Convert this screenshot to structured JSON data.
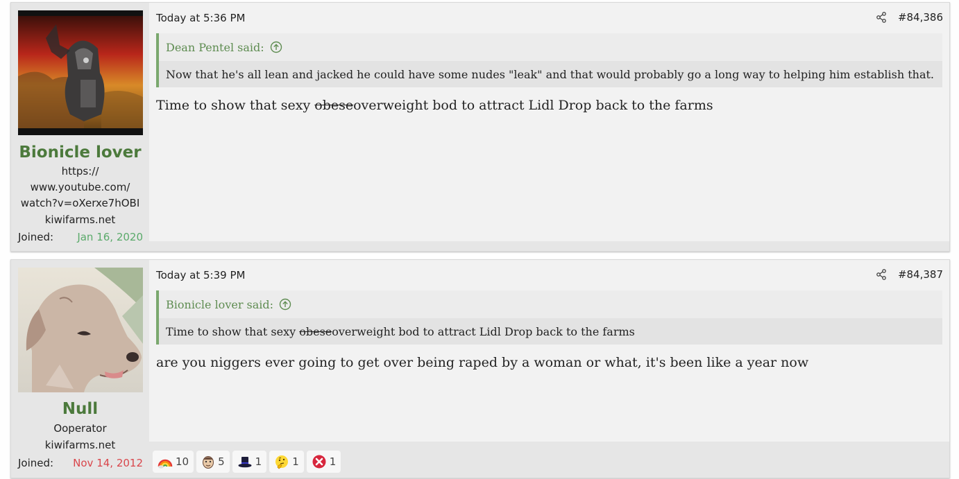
{
  "posts": [
    {
      "username": "Bionicle lover",
      "user_title_lines": [
        "https://",
        "www.youtube.com/",
        "watch?v=oXerxe7hOBI"
      ],
      "user_site": "kiwifarms.net",
      "joined_label": "Joined:",
      "joined_date": "Jan 16, 2020",
      "joined_color": "#5aaa6a",
      "date": "Today at 5:36 PM",
      "post_number": "#84,386",
      "quote": {
        "author": "Dean Pentel said:",
        "text": "Now that he's all lean and jacked he could have some nudes \"leak\" and that would probably go a long way to helping him establish that."
      },
      "message": {
        "before": "Time to show that sexy ",
        "struck": "obese",
        "after": "overweight bod to attract Lidl Drop back to the farms"
      }
    },
    {
      "username": "Null",
      "user_title_lines": [
        "Ooperator"
      ],
      "user_site": "kiwifarms.net",
      "joined_label": "Joined:",
      "joined_date": "Nov 14, 2012",
      "joined_color": "#d9464b",
      "date": "Today at 5:39 PM",
      "post_number": "#84,387",
      "quote": {
        "author": "Bionicle lover said:",
        "text_before": "Time to show that sexy ",
        "text_struck": "obese",
        "text_after": "overweight bod to attract Lidl Drop back to the farms"
      },
      "message": "are you niggers ever going to get over being raped by a woman or what, it's been like a year now",
      "reactions": [
        {
          "icon": "rainbow-icon",
          "count": "10"
        },
        {
          "icon": "face-icon",
          "count": "5"
        },
        {
          "icon": "top-hat-icon",
          "count": "1"
        },
        {
          "icon": "thinking-face-icon",
          "count": "1"
        },
        {
          "icon": "red-x-icon",
          "count": "1"
        }
      ]
    }
  ]
}
